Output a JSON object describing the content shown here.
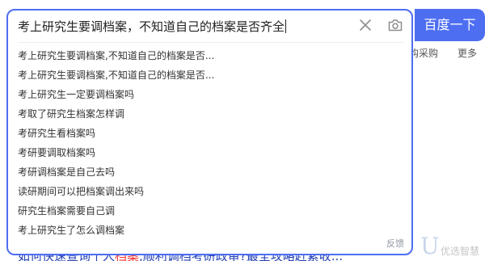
{
  "search": {
    "query": "考上研究生要调档案，不知道自己的档案是否齐全",
    "button_label": "百度一下",
    "feedback_label": "反馈"
  },
  "suggestions": [
    "考上研究生要调档案,不知道自己的档案是否...",
    "考上研究生要调档案,不知道自己的档案是否...",
    "考上研究生一定要调档案吗",
    "考取了研究生档案怎样调",
    "考研究生看档案吗",
    "考研要调取档案吗",
    "考研调档案是自己去吗",
    "读研期间可以把档案调出来吗",
    "研究生档案需要自己调",
    "考上研究生了怎么调档案"
  ],
  "background": {
    "nav_partial_1": "购采购",
    "nav_more": "更多",
    "result_link_start": "如何快速查询个人",
    "result_link_highlight": "档案",
    "result_link_end": ",顺利调档考研政审?最全攻略赶紧收...",
    "watermark_text": "优选智慧"
  },
  "colors": {
    "accent": "#4e6ef2",
    "highlight": "#f73131",
    "link": "#2440b3"
  },
  "icons": [
    "close-icon",
    "camera-icon"
  ]
}
